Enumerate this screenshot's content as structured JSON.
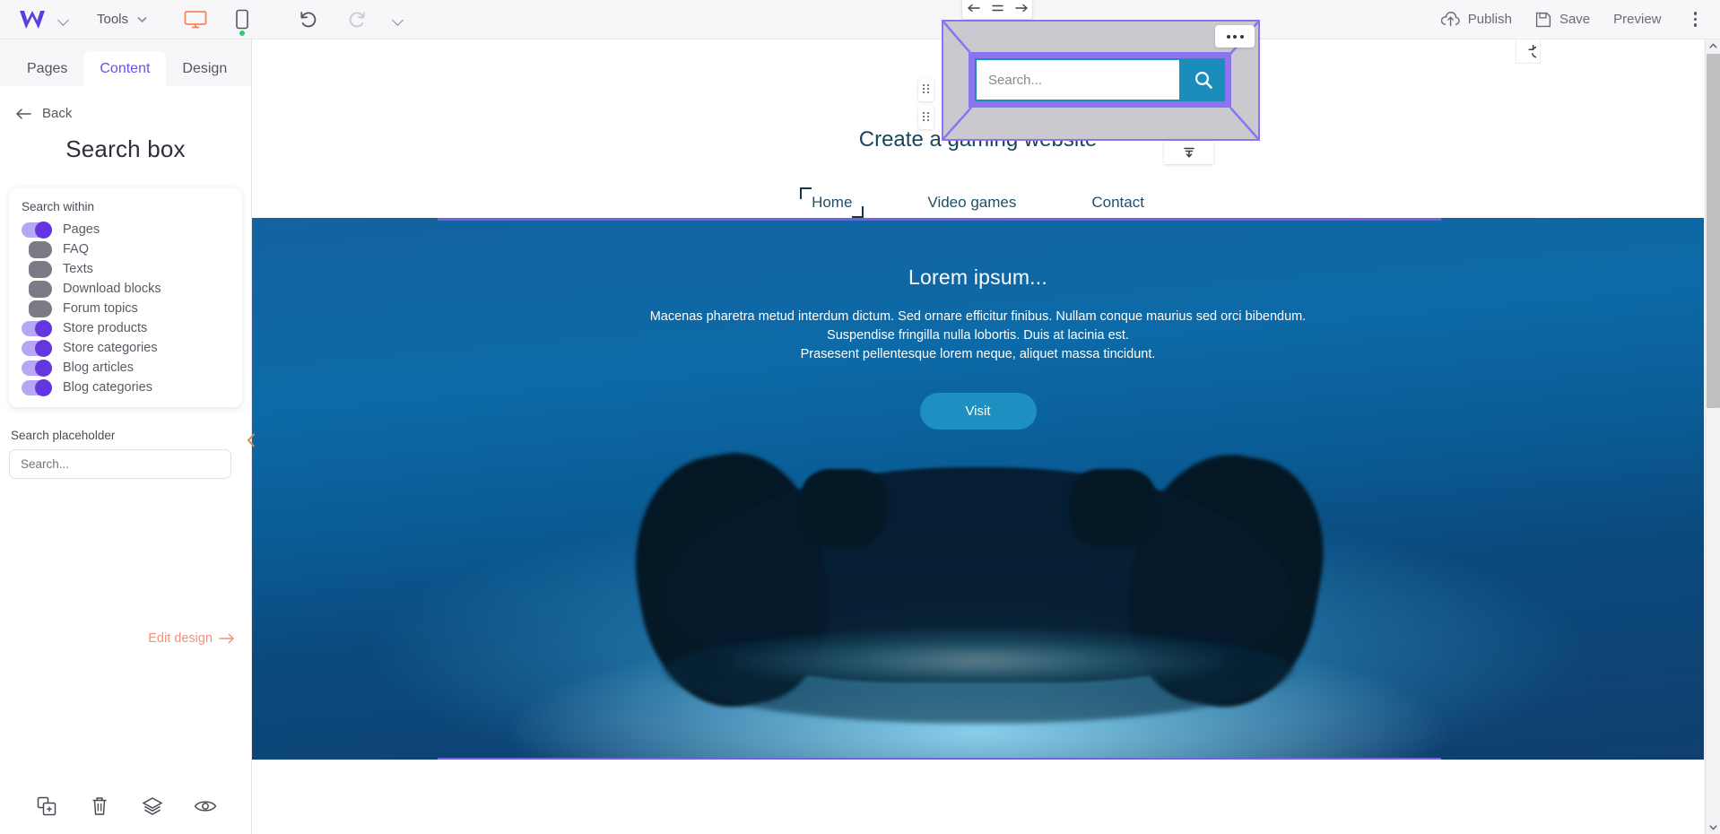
{
  "topbar": {
    "brand": "W",
    "brand_caret": "chevron-down",
    "tools_label": "Tools",
    "device_desktop": "desktop-view",
    "device_mobile": "mobile-view",
    "undo": "undo",
    "redo": "redo",
    "history_caret": "chevron-down",
    "publish_label": "Publish",
    "save_label": "Save",
    "preview_label": "Preview",
    "more_label": "more-options"
  },
  "panel": {
    "tabs": [
      {
        "label": "Pages",
        "active": false
      },
      {
        "label": "Content",
        "active": true
      },
      {
        "label": "Design",
        "active": false
      }
    ],
    "back_label": "Back",
    "title": "Search box",
    "search_within": {
      "label": "Search within",
      "options": [
        {
          "label": "Pages",
          "on": true
        },
        {
          "label": "FAQ",
          "on": false
        },
        {
          "label": "Texts",
          "on": false
        },
        {
          "label": "Download blocks",
          "on": false
        },
        {
          "label": "Forum topics",
          "on": false
        },
        {
          "label": "Store products",
          "on": true
        },
        {
          "label": "Store categories",
          "on": true
        },
        {
          "label": "Blog articles",
          "on": true
        },
        {
          "label": "Blog categories",
          "on": true
        }
      ]
    },
    "placeholder_field": {
      "label": "Search placeholder",
      "value": "",
      "placeholder": "Search..."
    },
    "edit_design_label": "Edit design",
    "footer_icons": [
      {
        "name": "duplicate-icon"
      },
      {
        "name": "delete-icon"
      },
      {
        "name": "layers-icon"
      },
      {
        "name": "visibility-icon"
      }
    ],
    "collapse_icon": "chevron-left"
  },
  "site": {
    "title": "Create a gaming website",
    "nav": [
      {
        "label": "Home",
        "marked": true
      },
      {
        "label": "Video games",
        "marked": false
      },
      {
        "label": "Contact",
        "marked": false
      }
    ],
    "hero": {
      "title": "Lorem ipsum...",
      "line1": "Macenas pharetra metud interdum dictum. Sed ornare efficitur finibus. Nullam conque maurius sed orci bibendum.",
      "line2": "Suspendise fringilla nulla lobortis. Duis at lacinia est.",
      "line3": "Prasesent pellentesque lorem neque, aliquet massa tincidunt.",
      "button_label": "Visit"
    }
  },
  "selection": {
    "search_widget": {
      "input_value": "",
      "input_placeholder": "Search...",
      "search_button": "search-icon",
      "align_left": "align-left-icon",
      "align_center": "align-center-icon",
      "align_right": "align-right-icon",
      "more": "more-dots",
      "drag_handle": "drag-handle",
      "bottom_handle": "align-bottom-icon",
      "reset": "reset-icon"
    }
  },
  "colors": {
    "accent_purple": "#6c4ee8",
    "selection_purple": "#8c74ee",
    "search_blue": "#1b8dbd",
    "edit_design_orange": "#f2907c",
    "nav_dark": "#1f4e68"
  }
}
